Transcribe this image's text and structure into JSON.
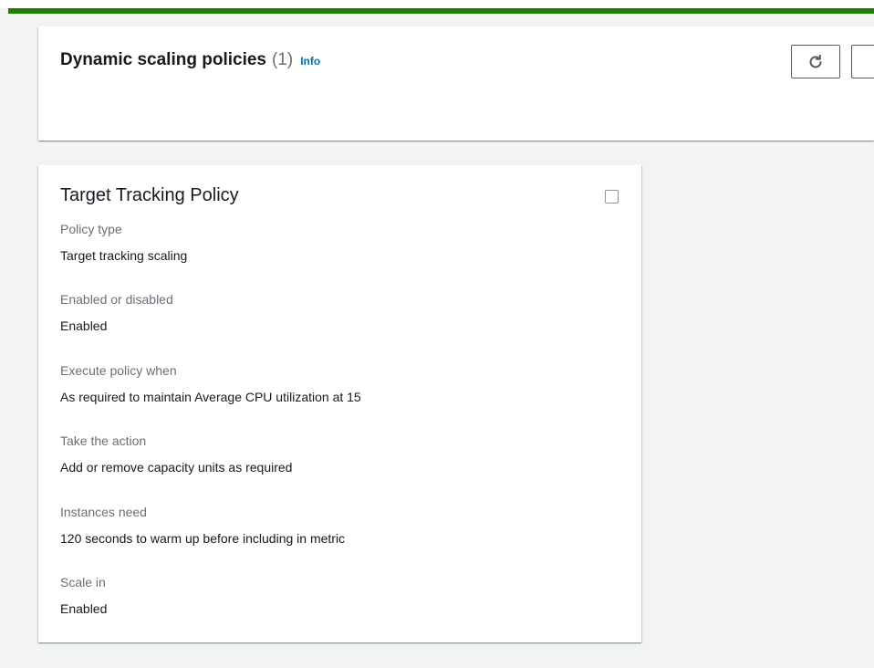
{
  "header": {
    "title": "Dynamic scaling policies",
    "count": "(1)",
    "info_label": "Info"
  },
  "icons": {
    "refresh": "refresh-icon"
  },
  "colors": {
    "top_bar": "#1d8102",
    "info_link": "#0073bb",
    "label_text": "#687078",
    "value_text": "#16191f"
  },
  "policy": {
    "title": "Target Tracking Policy",
    "fields": [
      {
        "label": "Policy type",
        "value": "Target tracking scaling"
      },
      {
        "label": "Enabled or disabled",
        "value": "Enabled"
      },
      {
        "label": "Execute policy when",
        "value": "As required to maintain Average CPU utilization at 15"
      },
      {
        "label": "Take the action",
        "value": "Add or remove capacity units as required"
      },
      {
        "label": "Instances need",
        "value": "120 seconds to warm up before including in metric"
      },
      {
        "label": "Scale in",
        "value": "Enabled"
      }
    ]
  }
}
